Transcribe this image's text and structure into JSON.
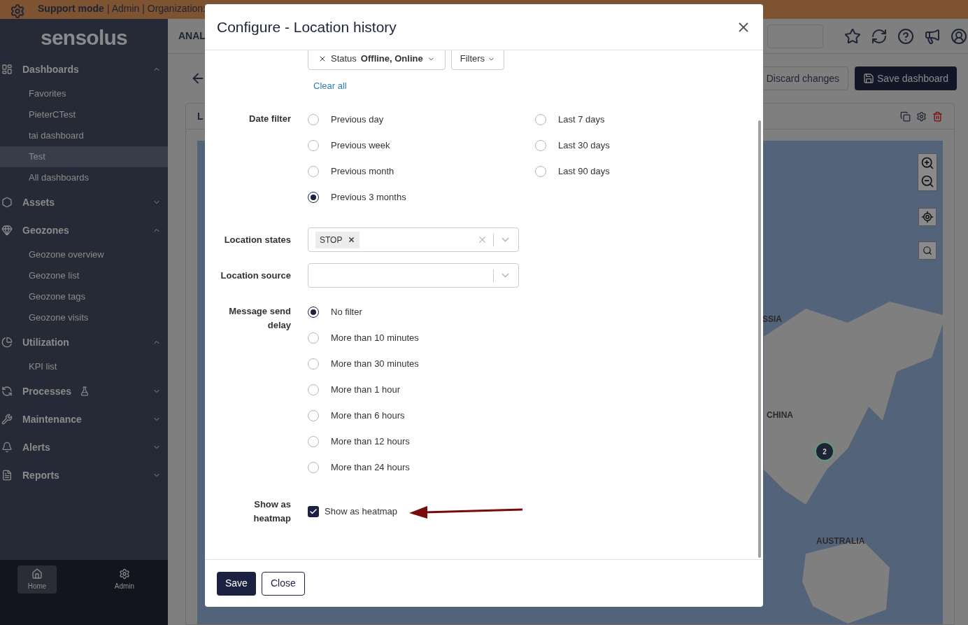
{
  "banner": {
    "mode": "Support mode",
    "rest": "| Admin | Organization:"
  },
  "sidebar": {
    "logo": "sensolus",
    "sections": [
      {
        "label": "Dashboards",
        "expanded": true,
        "children": [
          {
            "label": "Favorites",
            "selected": false
          },
          {
            "label": "PieterCTest",
            "selected": false
          },
          {
            "label": "tai dashboard",
            "selected": false
          },
          {
            "label": "Test",
            "selected": true
          },
          {
            "label": "All dashboards",
            "selected": false
          }
        ]
      },
      {
        "label": "Assets",
        "expanded": false
      },
      {
        "label": "Geozones",
        "expanded": true,
        "children": [
          {
            "label": "Geozone overview",
            "selected": false
          },
          {
            "label": "Geozone list",
            "selected": false
          },
          {
            "label": "Geozone tags",
            "selected": false
          },
          {
            "label": "Geozone visits",
            "selected": false
          }
        ]
      },
      {
        "label": "Utilization",
        "expanded": true,
        "children": [
          {
            "label": "KPI list",
            "selected": false
          }
        ]
      },
      {
        "label": "Processes",
        "expanded": false,
        "experimental": true
      },
      {
        "label": "Maintenance",
        "expanded": false
      },
      {
        "label": "Alerts",
        "expanded": false
      },
      {
        "label": "Reports",
        "expanded": false
      }
    ],
    "footer": [
      {
        "label": "Home",
        "selected": true
      },
      {
        "label": "Admin",
        "selected": false
      }
    ]
  },
  "header": {
    "title": "ANAL"
  },
  "toolbar": {
    "discard": "Discard changes",
    "save": "Save dashboard"
  },
  "card": {
    "title": "L"
  },
  "map": {
    "labels": [
      "SSIA",
      "CHINA",
      "AUSTRALIA"
    ],
    "cluster": "2"
  },
  "modal": {
    "title": "Configure - Location history",
    "chips": [
      {
        "label": "Status",
        "value": "Offline, Online"
      }
    ],
    "filters_button": "Filters",
    "clear_all": "Clear all",
    "date_filter": {
      "label": "Date filter",
      "columns": [
        [
          {
            "label": "Previous day",
            "selected": false
          },
          {
            "label": "Previous week",
            "selected": false
          },
          {
            "label": "Previous month",
            "selected": false
          },
          {
            "label": "Previous 3 months",
            "selected": true
          }
        ],
        [
          {
            "label": "Last 7 days",
            "selected": false
          },
          {
            "label": "Last 30 days",
            "selected": false
          },
          {
            "label": "Last 90 days",
            "selected": false
          }
        ]
      ]
    },
    "location_states": {
      "label": "Location states",
      "tags": [
        "STOP"
      ]
    },
    "location_source": {
      "label": "Location source"
    },
    "message_send_delay": {
      "label": "Message send delay",
      "options": [
        {
          "label": "No filter",
          "selected": true
        },
        {
          "label": "More than 10 minutes",
          "selected": false
        },
        {
          "label": "More than 30 minutes",
          "selected": false
        },
        {
          "label": "More than 1 hour",
          "selected": false
        },
        {
          "label": "More than 6 hours",
          "selected": false
        },
        {
          "label": "More than 12 hours",
          "selected": false
        },
        {
          "label": "More than 24 hours",
          "selected": false
        }
      ]
    },
    "heatmap": {
      "label": "Show as heatmap",
      "checkbox_label": "Show as heatmap",
      "checked": true
    },
    "buttons": [
      {
        "label": "Save",
        "kind": "primary"
      },
      {
        "label": "Close",
        "kind": "secondary"
      }
    ]
  }
}
